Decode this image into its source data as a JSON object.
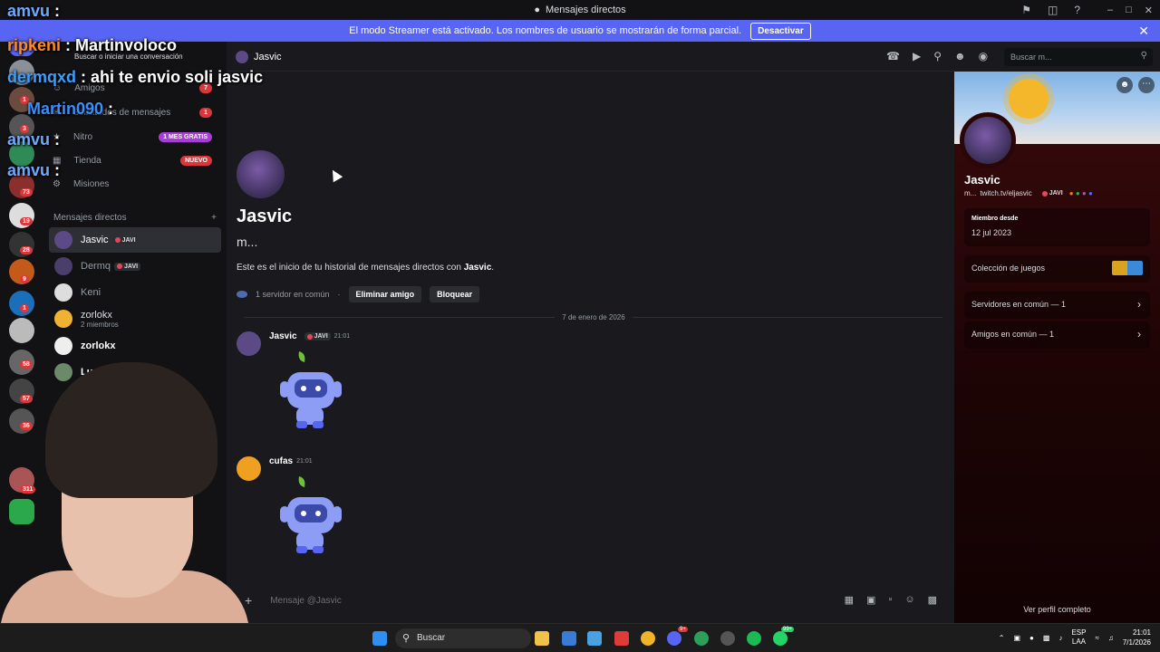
{
  "window": {
    "title": "Mensajes directos"
  },
  "streamer_banner": {
    "text": "El modo Streamer está activado. Los nombres de usuario se mostrarán de forma parcial.",
    "button": "Desactivar"
  },
  "rail_badges": [
    "1",
    "3",
    "73",
    "19",
    "28",
    "9",
    "1",
    "58",
    "57",
    "36",
    "311"
  ],
  "sidebar": {
    "search_placeholder": "Buscar o iniciar una conversación",
    "nav": [
      {
        "label": "Amigos",
        "badge": "7"
      },
      {
        "label": "Solicitudes de mensajes",
        "badge": "1"
      },
      {
        "label": "Nitro",
        "pill": "1 MES GRATIS"
      },
      {
        "label": "Tienda",
        "pill": "NUEVO"
      },
      {
        "label": "Misiones"
      }
    ],
    "dm_header": "Mensajes directos",
    "dm_add": "+",
    "dms": [
      {
        "name": "Jasvic",
        "tag": "JAVI"
      },
      {
        "name": "Dermq",
        "tag": "JAVI"
      },
      {
        "name": "Keni"
      },
      {
        "name": "zorlokx",
        "sub": "2 miembros"
      },
      {
        "name": "zorlokx"
      },
      {
        "name": "LucasZet"
      }
    ]
  },
  "main": {
    "header_name": "Jasvic",
    "search_placeholder": "Buscar m...",
    "profile_name": "Jasvic",
    "status": "m...",
    "intro_prefix": "Este es el inicio de tu historial de mensajes directos con ",
    "intro_name": "Jasvic",
    "intro_suffix": ".",
    "mutual_servers": "1 servidor en común",
    "dot": "·",
    "btn_remove": "Eliminar amigo",
    "btn_block": "Bloquear",
    "date_divider": "7 de enero de 2026",
    "messages": [
      {
        "author": "Jasvic",
        "tag": "JAVI",
        "time": "21:01"
      },
      {
        "author": "cufas",
        "time": "21:01"
      }
    ],
    "composer_placeholder": "Mensaje @Jasvic"
  },
  "profile": {
    "name": "Jasvic",
    "status_prefix": "m...",
    "link": "twitch.tv/eljasvic",
    "tag": "JAVI",
    "member_since_label": "Miembro desde",
    "member_since": "12 jul 2023",
    "games_label": "Colección de juegos",
    "mutual_servers": "Servidores en común — 1",
    "mutual_friends": "Amigos en común — 1",
    "view_full": "Ver perfil completo"
  },
  "taskbar": {
    "search": "Buscar",
    "lang_1": "ESP",
    "lang_2": "LAA",
    "time": "21:01",
    "date": "7/1/2026",
    "discord_badge": "9+",
    "whatsapp_badge": "99+"
  },
  "stream_chat": [
    {
      "user": "amvu",
      "text": ""
    },
    {
      "user": "ripkeni",
      "text": "Martinvoloco"
    },
    {
      "user": "dermqxd",
      "text": "ahi te envio soli jasvic"
    },
    {
      "user": "Martin090",
      "text": ""
    },
    {
      "user": "amvu",
      "text": ""
    },
    {
      "user": "amvu",
      "text": ""
    }
  ],
  "colors": {
    "brand": "#5865f2",
    "danger": "#da373c",
    "nitro_pill": "#a73cd6",
    "new_pill": "#da373c"
  }
}
